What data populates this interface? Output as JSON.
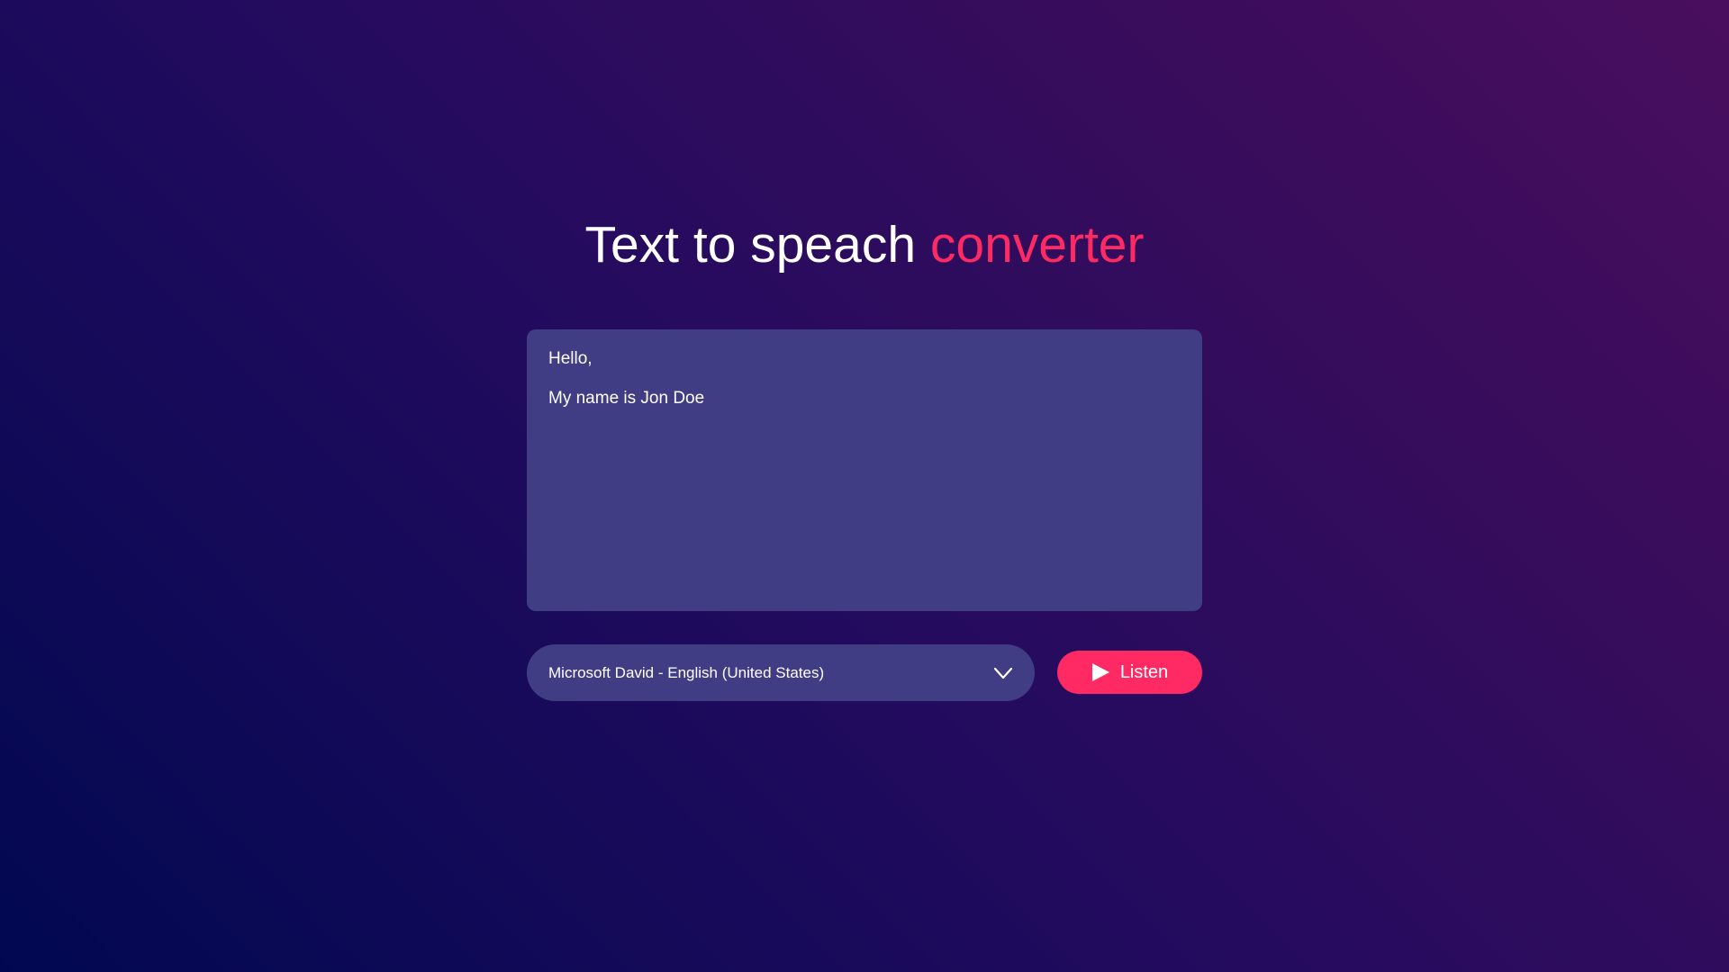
{
  "header": {
    "title_main": "Text to speach",
    "title_accent": "converter"
  },
  "editor": {
    "lines": [
      "Hello,",
      "My name is Jon Doe"
    ]
  },
  "voice_select": {
    "selected": "Microsoft David - English (United States)",
    "icon": "chevron-down-icon"
  },
  "listen_button": {
    "label": "Listen",
    "icon": "play-icon"
  },
  "colors": {
    "accent": "#ff2963",
    "panel": "#403d84",
    "background_start": "#010851",
    "background_end": "#4a0e5e",
    "text": "#ffffff"
  }
}
